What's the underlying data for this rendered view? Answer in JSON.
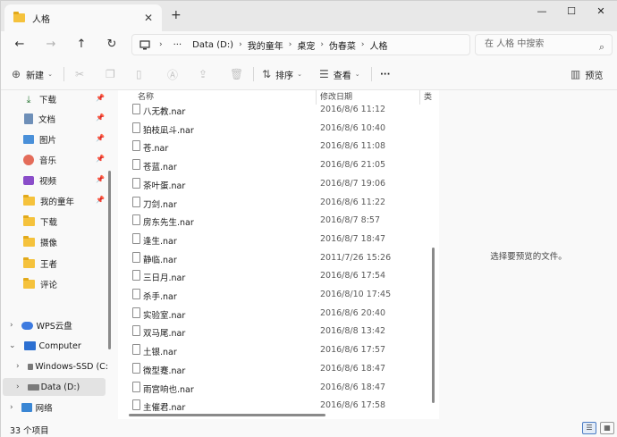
{
  "tab": {
    "title": "人格"
  },
  "window": {
    "minimize": "—",
    "maximize": "☐",
    "close": "✕"
  },
  "address": {
    "segments": [
      "Data (D:)",
      "我的童年",
      "桌宠",
      "伪春菜",
      "人格"
    ],
    "ellipsis": "···"
  },
  "search": {
    "placeholder": "在 人格 中搜索"
  },
  "toolbar": {
    "new_label": "新建",
    "sort_label": "排序",
    "view_label": "查看",
    "more_label": "···",
    "preview_label": "预览"
  },
  "sidebar": {
    "pinned": [
      {
        "label": "下载",
        "icon": "download-icon"
      },
      {
        "label": "文档",
        "icon": "document-icon"
      },
      {
        "label": "图片",
        "icon": "pictures-icon"
      },
      {
        "label": "音乐",
        "icon": "music-icon"
      },
      {
        "label": "视频",
        "icon": "video-icon"
      }
    ],
    "folders": [
      "我的童年",
      "下载",
      "摄像",
      "王者",
      "评论"
    ],
    "tree": [
      {
        "label": "WPS云盘",
        "icon": "cloud-icon"
      },
      {
        "label": "Computer",
        "icon": "computer-icon"
      },
      {
        "label": "Windows-SSD (C:",
        "icon": "drive-icon"
      },
      {
        "label": "Data (D:)",
        "icon": "drive-icon"
      },
      {
        "label": "网络",
        "icon": "network-icon"
      }
    ]
  },
  "columns": {
    "name": "名称",
    "date": "修改日期",
    "type": "类"
  },
  "files": [
    {
      "name": "八无教.nar",
      "date": "2016/8/6 11:12"
    },
    {
      "name": "狛枝凪斗.nar",
      "date": "2016/8/6 10:40"
    },
    {
      "name": "苍.nar",
      "date": "2016/8/6 11:08"
    },
    {
      "name": "苍蓝.nar",
      "date": "2016/8/6 21:05"
    },
    {
      "name": "茶叶蛋.nar",
      "date": "2016/8/7 19:06"
    },
    {
      "name": "刀剑.nar",
      "date": "2016/8/6 11:22"
    },
    {
      "name": "房东先生.nar",
      "date": "2016/8/7 8:57"
    },
    {
      "name": "逢生.nar",
      "date": "2016/8/7 18:47"
    },
    {
      "name": "静临.nar",
      "date": "2011/7/26 15:26"
    },
    {
      "name": "三日月.nar",
      "date": "2016/8/6 17:54"
    },
    {
      "name": "杀手.nar",
      "date": "2016/8/10 17:45"
    },
    {
      "name": "实验室.nar",
      "date": "2016/8/6 20:40"
    },
    {
      "name": "双马尾.nar",
      "date": "2016/8/8 13:42"
    },
    {
      "name": "土银.nar",
      "date": "2016/8/6 17:57"
    },
    {
      "name": "微型蹇.nar",
      "date": "2016/8/6 18:47"
    },
    {
      "name": "雨宫响也.nar",
      "date": "2016/8/6 18:47"
    },
    {
      "name": "主催君.nar",
      "date": "2016/8/6 17:58"
    }
  ],
  "preview": {
    "empty_text": "选择要预览的文件。"
  },
  "status": {
    "count": "33 个项目"
  }
}
